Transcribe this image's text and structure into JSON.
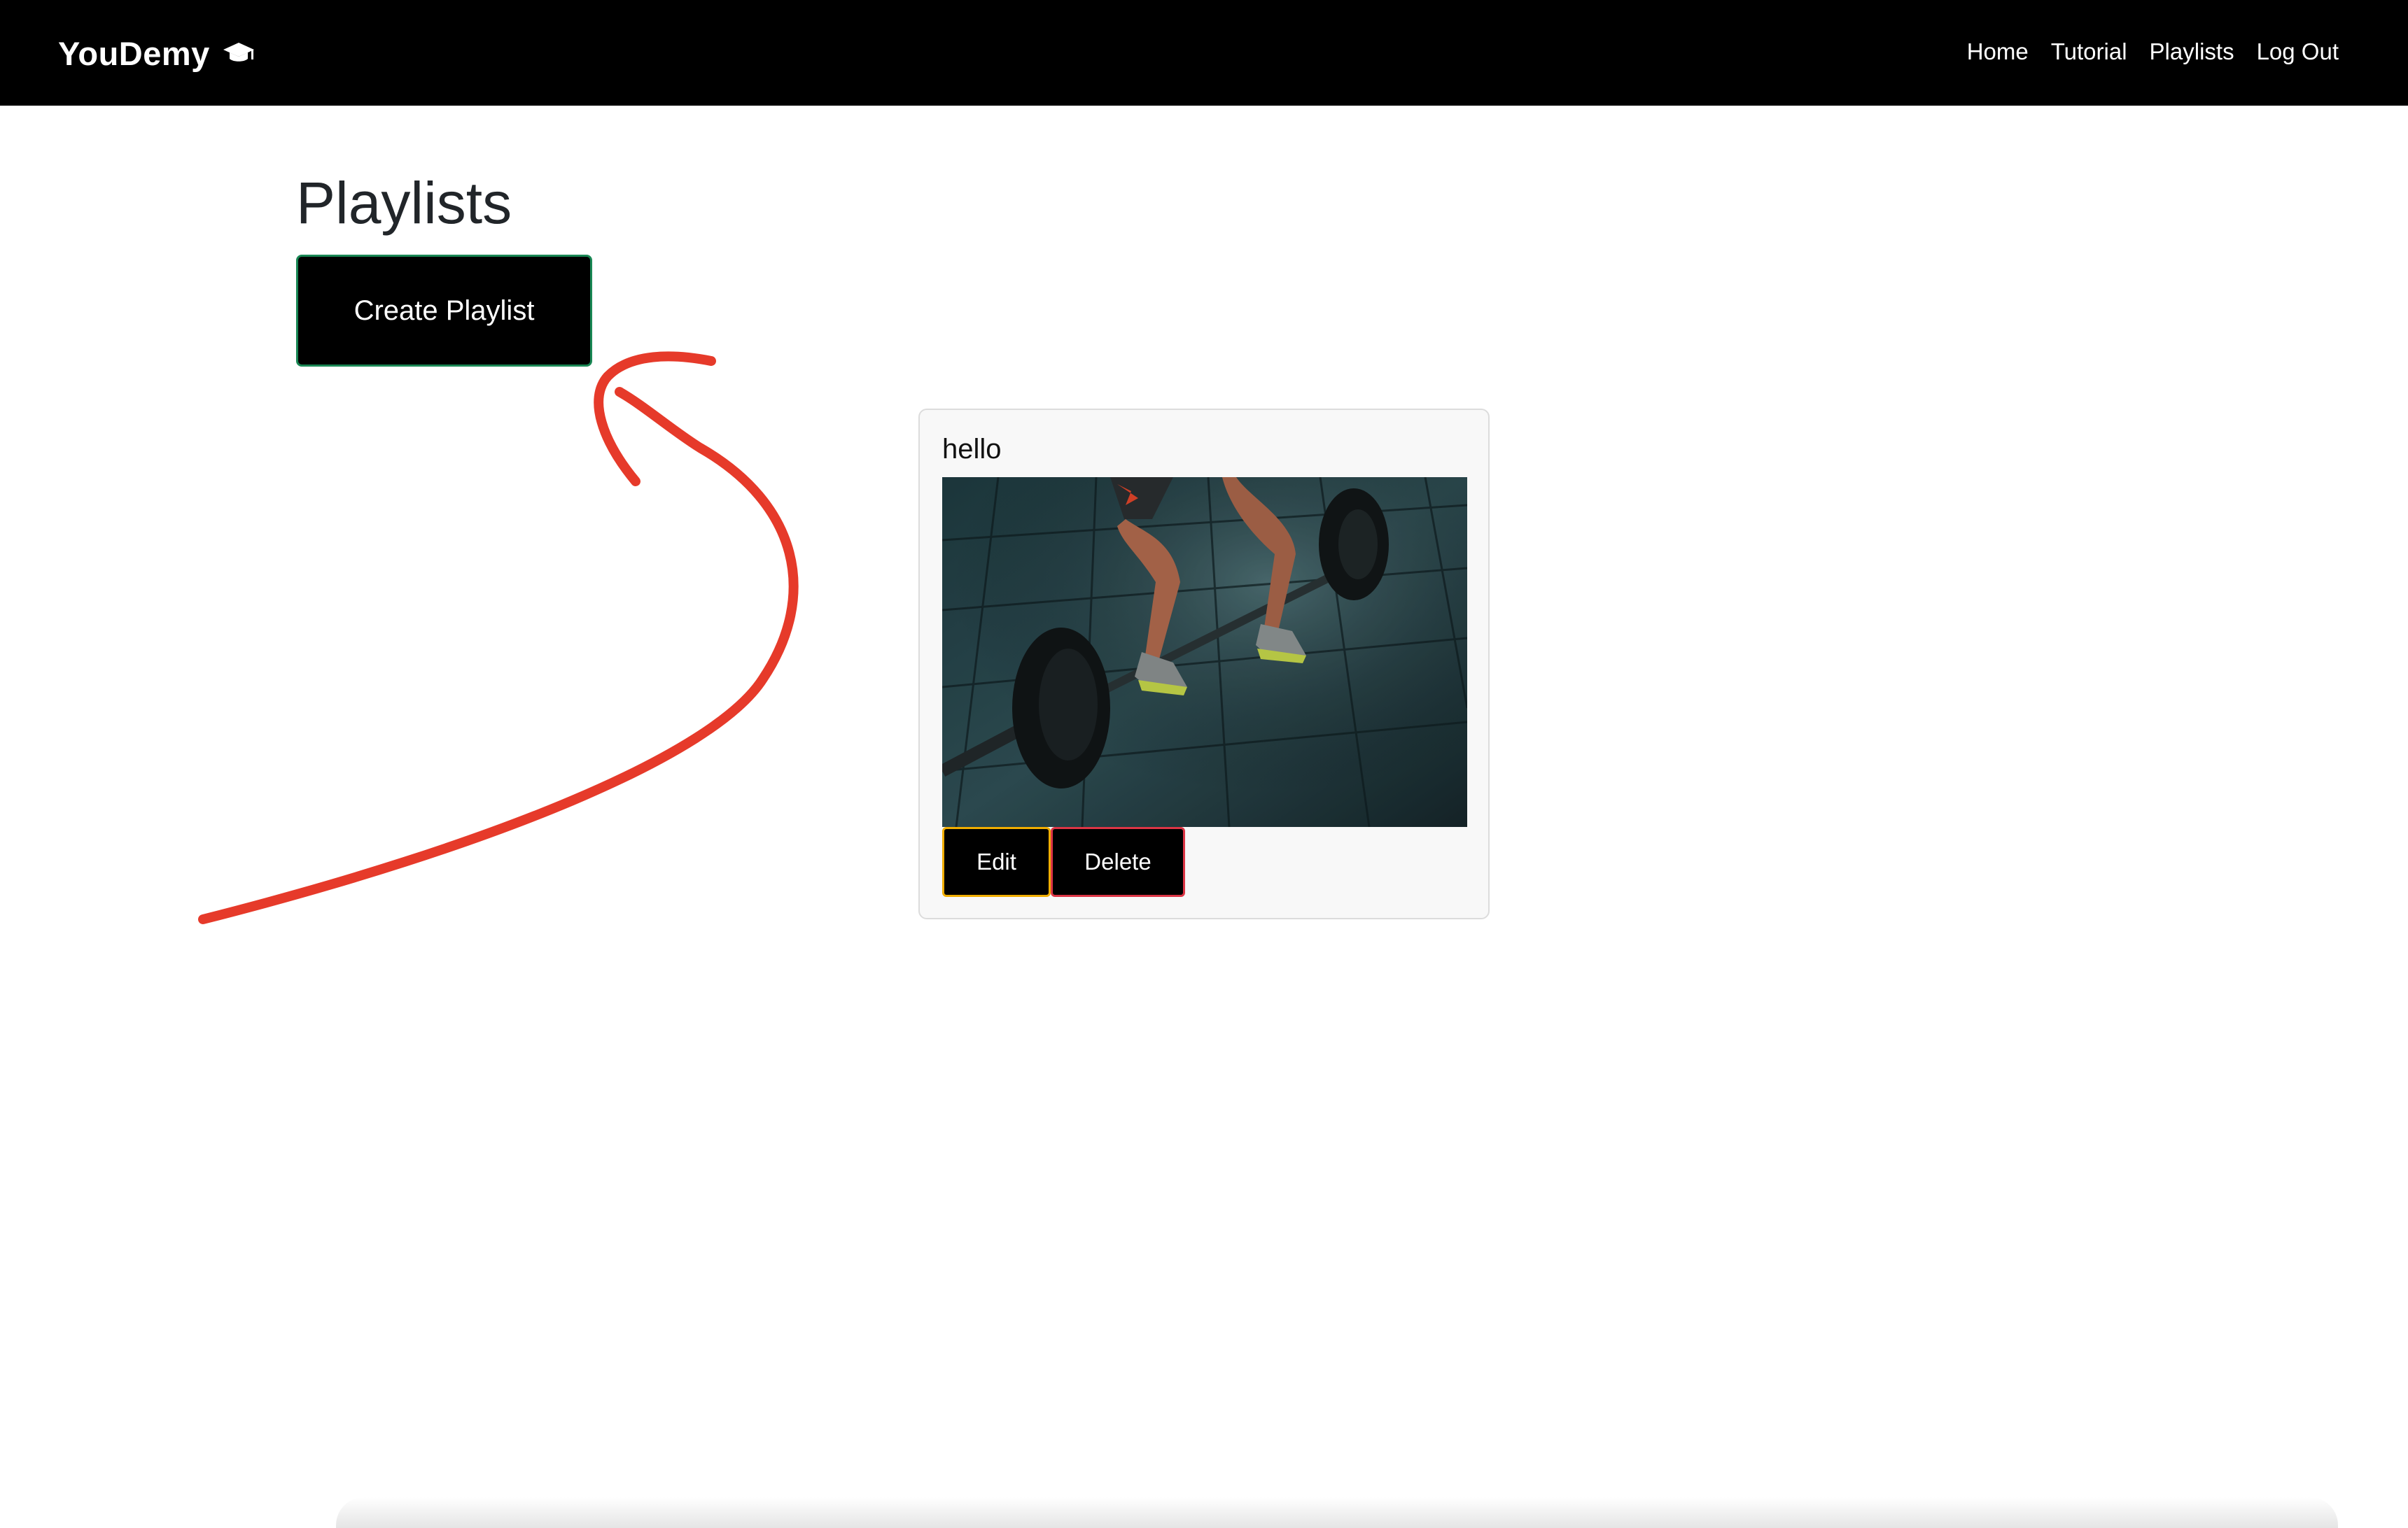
{
  "navbar": {
    "brand": "YouDemy",
    "brand_icon": "graduation-cap-icon",
    "links": [
      "Home",
      "Tutorial",
      "Playlists",
      "Log Out"
    ]
  },
  "main": {
    "title": "Playlists",
    "create_button": "Create Playlist"
  },
  "playlists": [
    {
      "title": "hello",
      "image": "weightlifter-barbell-photo",
      "edit_label": "Edit",
      "delete_label": "Delete"
    }
  ],
  "colors": {
    "navbar_bg": "#000000",
    "create_border": "#198754",
    "edit_border": "#f0ad00",
    "delete_border": "#dc3545",
    "annotation": "#e63a2a"
  }
}
